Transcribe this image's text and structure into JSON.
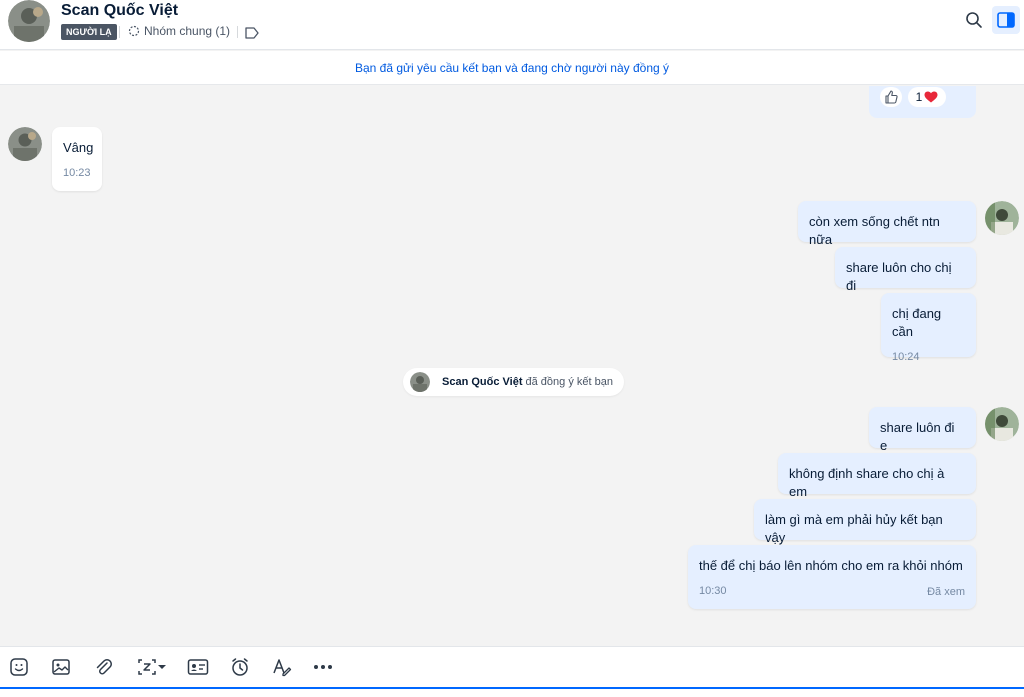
{
  "header": {
    "name": "Scan Quốc Việt",
    "badge": "NGƯỜI LẠ",
    "group_label": "Nhóm chung (1)"
  },
  "notice": "Bạn đã gửi yêu cầu kết bạn và đang chờ người này đồng ý",
  "reactions": {
    "count": "1"
  },
  "messages": [
    {
      "side": "in",
      "text": "Vâng",
      "time": "10:23"
    },
    {
      "side": "out",
      "text": "còn xem sống chết ntn nữa"
    },
    {
      "side": "out",
      "text": "share luôn cho chị đi"
    },
    {
      "side": "out",
      "text": "chị đang cần",
      "time": "10:24"
    },
    {
      "side": "out",
      "text": "share luôn đi e"
    },
    {
      "side": "out",
      "text": "không định share cho chị à em"
    },
    {
      "side": "out",
      "text": "làm gì mà em phải hủy kết bạn vậy"
    },
    {
      "side": "out",
      "text": "thế để chị báo lên nhóm cho em ra khỏi nhóm",
      "time": "10:30",
      "status": "Đã xem"
    }
  ],
  "system": {
    "who": "Scan Quốc Việt",
    "action": "đã đồng ý kết bạn"
  },
  "toolbar": {
    "icons": [
      "sticker-icon",
      "image-icon",
      "attachment-icon",
      "screenshot-icon",
      "contact-card-icon",
      "reminder-icon",
      "format-text-icon",
      "more-icon"
    ]
  },
  "colors": {
    "accent": "#0068ff",
    "bubble_out": "#e5efff",
    "notice_text": "#005ae0",
    "badge_bg": "#4b5563"
  }
}
